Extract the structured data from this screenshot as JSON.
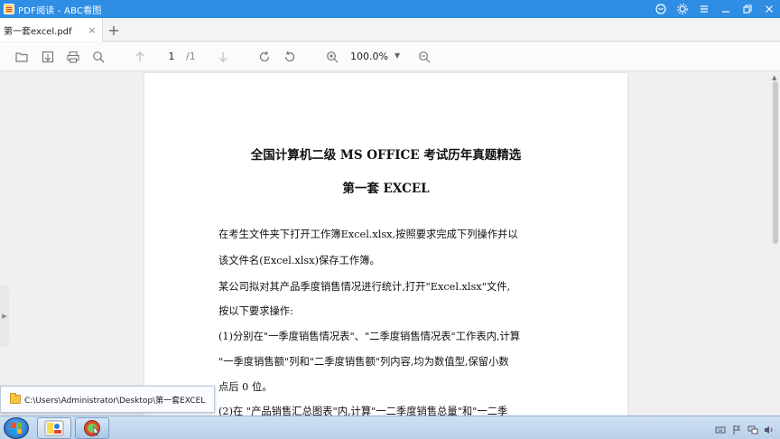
{
  "window": {
    "title": "PDF阅读 - ABC看图"
  },
  "tabs": [
    {
      "label": "第一套excel.pdf",
      "close": "×"
    }
  ],
  "newtab": {
    "symbol": "+"
  },
  "toolbar": {
    "page_current": "1",
    "page_total": "/1",
    "zoom": "100.0%",
    "zoom_arrow": "▼"
  },
  "document": {
    "title": "全国计算机二级 MS OFFICE 考试历年真题精选",
    "subtitle": "第一套 EXCEL",
    "lines": [
      "在考生文件夹下打开工作簿Excel.xlsx,按照要求完成下列操作并以",
      "该文件名(Excel.xlsx)保存工作簿。",
      "某公司拟对其产品季度销售情况进行统计,打开\"Excel.xlsx\"文件,",
      "按以下要求操作:",
      "(1)分别在\"一季度销售情况表\"、\"二季度销售情况表\"工作表内,计算",
      "\"一季度销售额\"列和\"二季度销售额\"列内容,均为数值型,保留小数",
      "点后 0 位。",
      "(2)在 \"产品销售汇总图表\"内,计算\"一二季度销售总量\"和\"一二季"
    ]
  },
  "taskbar": {
    "tooltip_path": "C:\\Users\\Administrator\\Desktop\\第一套EXCEL"
  },
  "colors": {
    "titlebar": "#2f8de4",
    "taskbar": "#b9d1ea"
  }
}
